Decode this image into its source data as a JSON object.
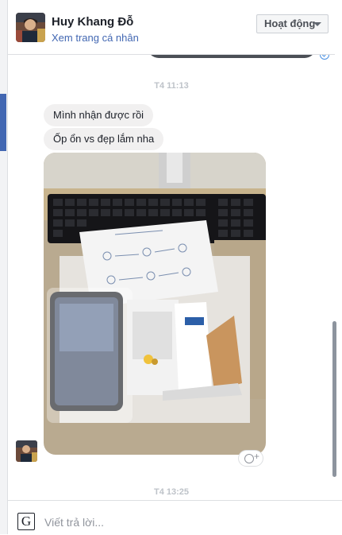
{
  "header": {
    "name": "Huy Khang Đỗ",
    "profile_link": "Xem trang cá nhân",
    "status_label": "Hoạt động",
    "avatar_icon": "user-avatar-icon"
  },
  "thread": {
    "timestamp_1": "T4 11:13",
    "messages": [
      {
        "text": "Mình nhận được rồi"
      },
      {
        "text": "Ốp ổn vs đẹp lắm nha"
      }
    ],
    "photo_icon": "photo-attachment",
    "timestamp_2": "T4 13:25"
  },
  "composer": {
    "placeholder": "Viết trả lời...",
    "g_icon_label": "G"
  },
  "colors": {
    "accent": "#4267b2",
    "bubble": "#f1f0f0",
    "timestamp": "#bec3c9"
  }
}
